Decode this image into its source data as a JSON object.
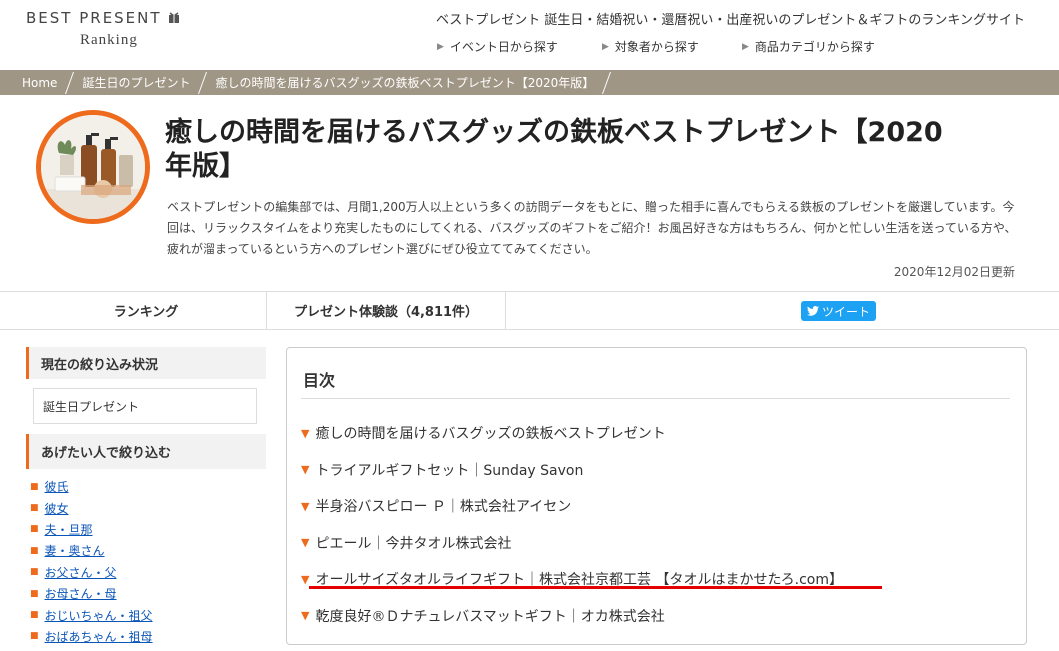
{
  "header": {
    "logo_main": "BEST PRESENT",
    "logo_sub": "Ranking",
    "tagline": "ベストプレゼント 誕生日・結婚祝い・還暦祝い・出産祝いのプレゼント＆ギフトのランキングサイト",
    "nav": [
      "イベント日から探す",
      "対象者から探す",
      "商品カテゴリから探す"
    ]
  },
  "breadcrumb": [
    "Home",
    "誕生日のプレゼント",
    "癒しの時間を届けるバスグッズの鉄板ベストプレゼント【2020年版】"
  ],
  "hero": {
    "title": "癒しの時間を届けるバスグッズの鉄板ベストプレゼント【2020年版】",
    "description": "ベストプレゼントの編集部では、月間1,200万人以上という多くの訪問データをもとに、贈った相手に喜んでもらえる鉄板のプレゼントを厳選しています。今回は、リラックスタイムをより充実したものにしてくれる、バスグッズのギフトをご紹介！お風呂好きな方はもちろん、何かと忙しい生活を送っている方や、疲れが溜まっているという方へのプレゼント選びにぜひ役立ててみてください。",
    "updated": "2020年12月02日更新"
  },
  "tabs": {
    "ranking": "ランキング",
    "reviews": "プレゼント体験談（4,811件）",
    "tweet": "ツイート"
  },
  "sidebar": {
    "filter_heading": "現在の絞り込み状況",
    "filter_value": "誕生日プレゼント",
    "recipient_heading": "あげたい人で絞り込む",
    "recipients": [
      "彼氏",
      "彼女",
      "夫・旦那",
      "妻・奥さん",
      "お父さん・父",
      "お母さん・母",
      "おじいちゃん・祖父",
      "おばあちゃん・祖母"
    ]
  },
  "toc": {
    "title": "目次",
    "items": [
      "癒しの時間を届けるバスグッズの鉄板ベストプレゼント",
      "トライアルギフトセット｜Sunday Savon",
      "半身浴バスピロー Ｐ｜株式会社アイセン",
      "ピエール｜今井タオル株式会社",
      "オールサイズタオルライフギフト｜株式会社京都工芸 【タオルはまかせたろ.com】",
      "乾度良好®Ｄナチュレバスマットギフト｜オカ株式会社"
    ]
  },
  "colors": {
    "accent": "#ee6a1c",
    "breadcrumb_bg": "#a09685",
    "link": "#0a55b8",
    "tweet": "#1da1f2",
    "highlight": "#e20000"
  }
}
